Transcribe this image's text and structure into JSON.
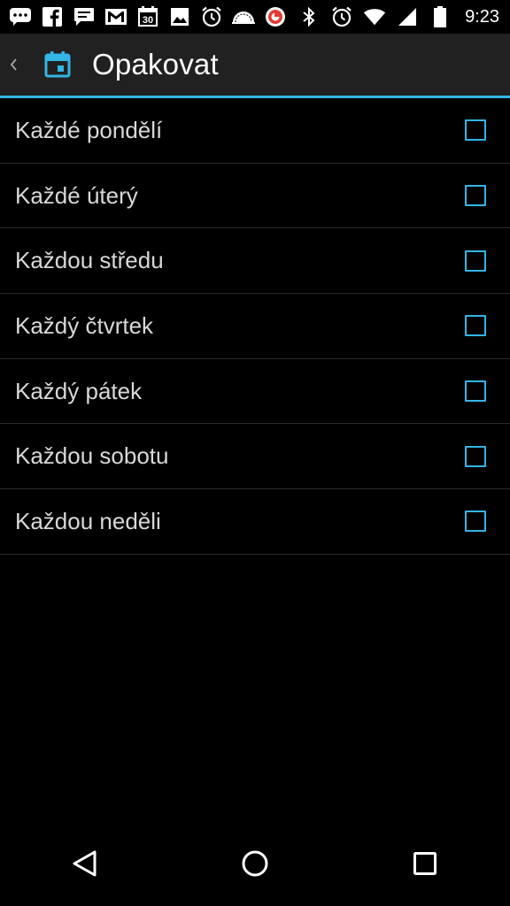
{
  "status_bar": {
    "time": "9:23",
    "calendar_date": "30",
    "icons": [
      "chat-icon",
      "facebook-icon",
      "message-icon",
      "gmail-icon",
      "calendar-icon",
      "image-icon",
      "alarm-icon",
      "cloud-icon",
      "app-notification-icon",
      "bluetooth-icon",
      "alarm-icon",
      "wifi-icon",
      "signal-icon",
      "battery-icon"
    ]
  },
  "action_bar": {
    "title": "Opakovat",
    "icon": "calendar-icon",
    "accent_color": "#33b5e5"
  },
  "days": [
    {
      "label": "Každé pondělí",
      "checked": false
    },
    {
      "label": "Každé úterý",
      "checked": false
    },
    {
      "label": "Každou středu",
      "checked": false
    },
    {
      "label": "Každý čtvrtek",
      "checked": false
    },
    {
      "label": "Každý pátek",
      "checked": false
    },
    {
      "label": "Každou sobotu",
      "checked": false
    },
    {
      "label": "Každou neděli",
      "checked": false
    }
  ],
  "nav_bar": {
    "buttons": [
      "back-icon",
      "home-icon",
      "recents-icon"
    ]
  }
}
